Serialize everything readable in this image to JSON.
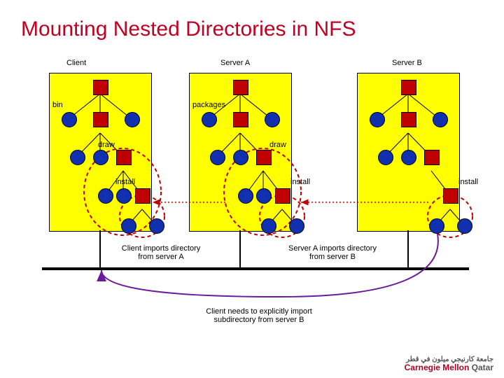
{
  "title": "Mounting Nested Directories in NFS",
  "columns": {
    "client": "Client",
    "serverA": "Server A",
    "serverB": "Server B"
  },
  "nodes": {
    "bin": "bin",
    "packages": "packages",
    "draw": "draw",
    "install": "install"
  },
  "captions": {
    "importA": "Client imports directory\nfrom server A",
    "importB": "Server A imports directory\nfrom server B",
    "bottom": "Client needs to explicitly import\nsubdirectory from server B"
  },
  "footer": {
    "arabic": "جامعة كارنيجي ميلون في قطر",
    "en1": "Carnegie Mellon",
    "en2": "Qatar"
  }
}
